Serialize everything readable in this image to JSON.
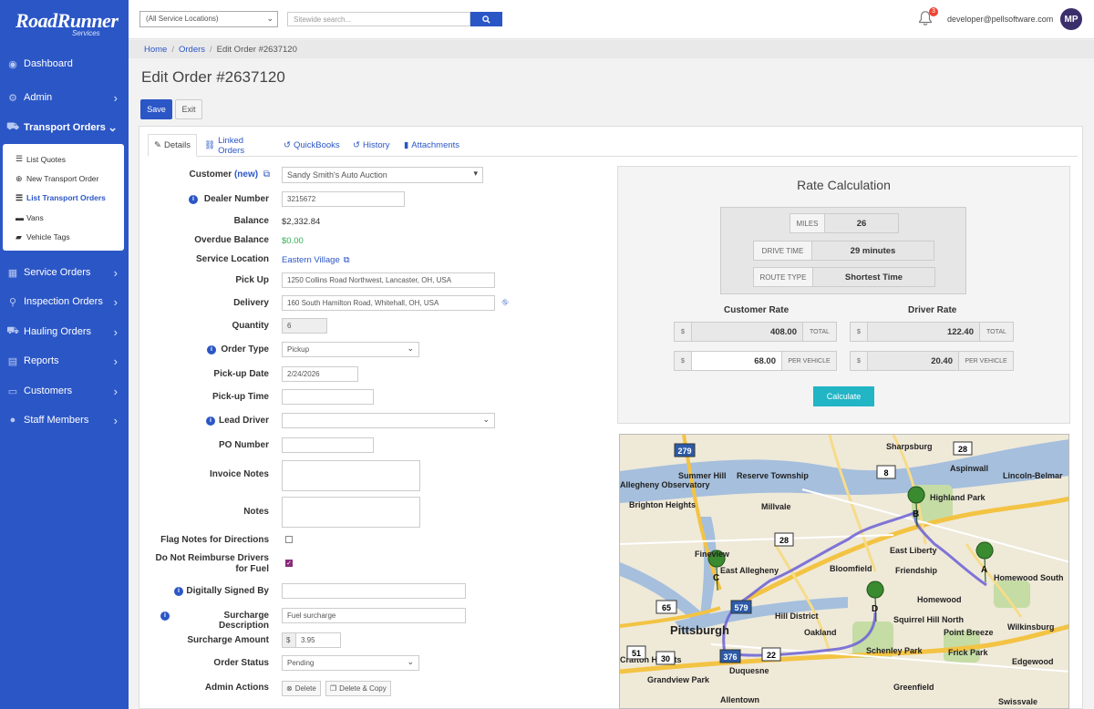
{
  "brand": {
    "name": "RoadRunner",
    "sub": "Services"
  },
  "sidebar": {
    "items": [
      {
        "label": "Dashboard",
        "icon": "dashboard-icon"
      },
      {
        "label": "Admin",
        "icon": "admin-gears-icon"
      },
      {
        "label": "Transport Orders",
        "icon": "truck-icon"
      },
      {
        "label": "Service Orders",
        "icon": "service-grid-icon"
      },
      {
        "label": "Inspection Orders",
        "icon": "search-icon"
      },
      {
        "label": "Hauling Orders",
        "icon": "truck-icon"
      },
      {
        "label": "Reports",
        "icon": "chart-icon"
      },
      {
        "label": "Customers",
        "icon": "id-card-icon"
      },
      {
        "label": "Staff Members",
        "icon": "users-icon"
      }
    ],
    "submenu": [
      {
        "label": "List Quotes",
        "icon": "list-icon"
      },
      {
        "label": "New Transport Order",
        "icon": "plus-circle-icon"
      },
      {
        "label": "List Transport Orders",
        "icon": "list-icon"
      },
      {
        "label": "Vans",
        "icon": "van-icon"
      },
      {
        "label": "Vehicle Tags",
        "icon": "car-icon"
      }
    ]
  },
  "topbar": {
    "location_select": "(All Service Locations)",
    "search_placeholder": "Sitewide search...",
    "notification_count": "3",
    "user_email": "developer@pellsoftware.com",
    "user_initials": "MP"
  },
  "breadcrumb": {
    "home": "Home",
    "orders": "Orders",
    "current": "Edit Order #2637120"
  },
  "page": {
    "title": "Edit Order #2637120",
    "save": "Save",
    "exit": "Exit"
  },
  "tabs": [
    {
      "label": "Details",
      "icon": "edit-icon"
    },
    {
      "label": "Linked Orders",
      "icon": "link-icon"
    },
    {
      "label": "QuickBooks",
      "icon": "history-icon"
    },
    {
      "label": "History",
      "icon": "history-icon"
    },
    {
      "label": "Attachments",
      "icon": "file-icon"
    }
  ],
  "form": {
    "customer_label": "Customer",
    "customer_new": "(new)",
    "customer_value": "Sandy Smith's Auto Auction",
    "dealer_number_label": "Dealer Number",
    "dealer_number": "3215672",
    "balance_label": "Balance",
    "balance": "$2,332.84",
    "overdue_label": "Overdue Balance",
    "overdue": "$0.00",
    "service_location_label": "Service Location",
    "service_location": "Eastern Village",
    "pickup_label": "Pick Up",
    "pickup": "1250 Collins Road Northwest, Lancaster, OH, USA",
    "delivery_label": "Delivery",
    "delivery": "160 South Hamilton Road, Whitehall, OH, USA",
    "quantity_label": "Quantity",
    "quantity": "6",
    "order_type_label": "Order Type",
    "order_type": "Pickup",
    "pickup_date_label": "Pick-up Date",
    "pickup_date": "2/24/2026",
    "pickup_time_label": "Pick-up Time",
    "pickup_time": "",
    "lead_driver_label": "Lead Driver",
    "lead_driver": "",
    "po_label": "PO Number",
    "po": "",
    "invoice_notes_label": "Invoice Notes",
    "notes_label": "Notes",
    "flag_notes_label": "Flag Notes for Directions",
    "flag_notes_checked": false,
    "no_reimburse_label_1": "Do Not Reimburse Drivers",
    "no_reimburse_label_2": "for Fuel",
    "no_reimburse_checked": true,
    "signed_by_label": "Digitally Signed By",
    "signed_by": "",
    "surcharge_desc_label": "Surcharge Description",
    "surcharge_desc": "Fuel surcharge",
    "surcharge_amount_label": "Surcharge Amount",
    "currency": "$",
    "surcharge_amount": "3.95",
    "order_status_label": "Order Status",
    "order_status": "Pending",
    "admin_actions_label": "Admin Actions",
    "delete": "Delete",
    "delete_copy": "Delete & Copy"
  },
  "rate": {
    "title": "Rate Calculation",
    "miles_label": "MILES",
    "miles": "26",
    "drive_time_label": "DRIVE TIME",
    "drive_time": "29 minutes",
    "route_type_label": "ROUTE TYPE",
    "route_type": "Shortest Time",
    "customer_rate_label": "Customer Rate",
    "driver_rate_label": "Driver Rate",
    "currency": "$",
    "customer_total": "408.00",
    "customer_per_vehicle": "68.00",
    "driver_total": "122.40",
    "driver_per_vehicle": "20.40",
    "total_label": "TOTAL",
    "per_vehicle_label": "PER VEHICLE",
    "calculate": "Calculate"
  },
  "map": {
    "places": [
      "Sharpsburg",
      "Aspinwall",
      "Allegheny Observatory",
      "Summer Hill",
      "Reserve Township",
      "Millvale",
      "Brighton Heights",
      "Highland Park",
      "Lincoln-Belmar",
      "East Liberty",
      "Fineview",
      "East Allegheny",
      "Bloomfield",
      "Friendship",
      "Homewood",
      "Pittsburgh",
      "Hill District",
      "Squirrel Hill North",
      "Oakland",
      "Point Breeze",
      "Wilkinsburg",
      "Schenley Park",
      "Frick Park",
      "Edgewood",
      "Swissvale",
      "Allentown",
      "Greenfield",
      "Crafton Heights",
      "Grandview Park",
      "Duquesne",
      "Homewood South"
    ],
    "markers": [
      "A",
      "B",
      "C",
      "D"
    ],
    "routes": [
      "28",
      "8",
      "279",
      "65",
      "579",
      "51",
      "30",
      "22",
      "376",
      "28"
    ]
  }
}
